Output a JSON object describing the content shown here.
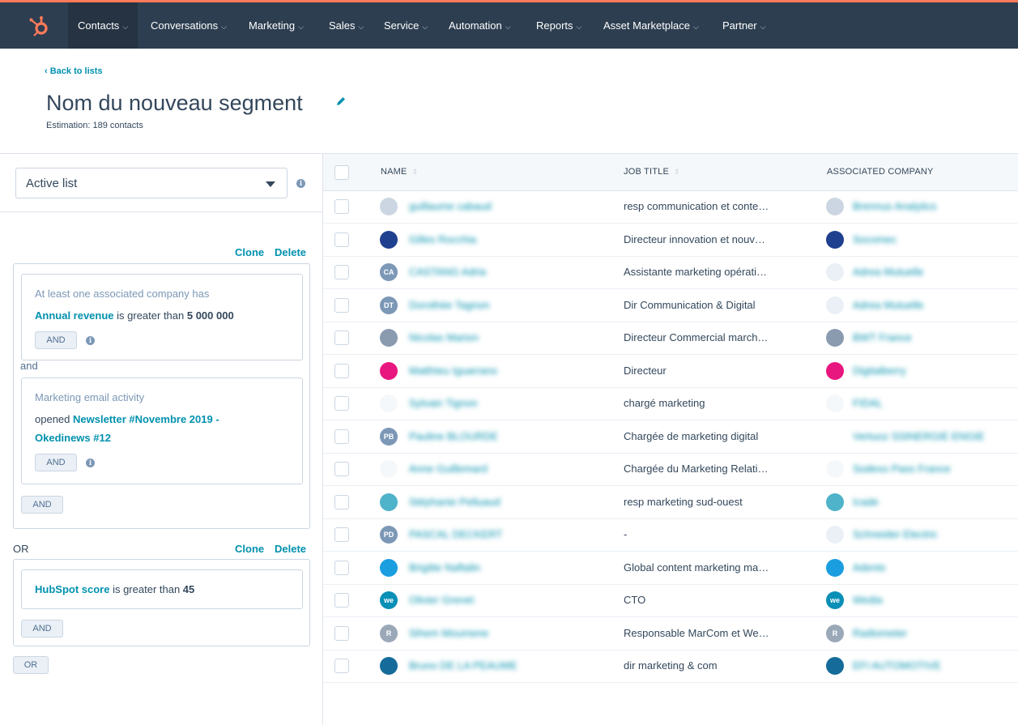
{
  "nav": {
    "items": [
      {
        "label": "Contacts"
      },
      {
        "label": "Conversations"
      },
      {
        "label": "Marketing"
      },
      {
        "label": "Sales"
      },
      {
        "label": "Service"
      },
      {
        "label": "Automation"
      },
      {
        "label": "Reports"
      },
      {
        "label": "Asset Marketplace"
      },
      {
        "label": "Partner"
      }
    ]
  },
  "header": {
    "back_link": "‹  Back to lists",
    "title": "Nom du nouveau segment",
    "estimate": "Estimation: 189 contacts"
  },
  "filters": {
    "list_type": "Active list",
    "clone_label": "Clone",
    "delete_label": "Delete",
    "and_connector": "and",
    "or_label": "OR",
    "and_button": "AND",
    "or_button": "OR",
    "group1": {
      "filter1": {
        "title": "At least one associated company has",
        "property": "Annual revenue",
        "operator": " is greater than ",
        "value": "5 000 000"
      },
      "filter2": {
        "title": "Marketing email activity",
        "operator": "opened ",
        "value_line1": "Newsletter #Novembre 2019 -",
        "value_line2": "Okedinews #12"
      }
    },
    "group2": {
      "filter1": {
        "property": "HubSpot score",
        "operator": " is greater than ",
        "value": "45"
      }
    }
  },
  "table": {
    "headers": {
      "name": "NAME",
      "job_title": "JOB TITLE",
      "company": "ASSOCIATED COMPANY"
    },
    "rows": [
      {
        "name": "guillaume cabaud",
        "job": "resp communication et conte…",
        "company": "Brennus Analytics",
        "initials": "",
        "color": "#cbd6e2",
        "cinitials": "",
        "ccolor": "#cbd6e2"
      },
      {
        "name": "Gilles Rocchia",
        "job": "Directeur innovation et nouv…",
        "company": "Socomec",
        "initials": "",
        "color": "#1f3f8f",
        "cinitials": "",
        "ccolor": "#1f3f8f"
      },
      {
        "name": "CASTANG Adria",
        "job": "Assistante marketing opérati…",
        "company": "Adrea Mutuelle",
        "initials": "CA",
        "color": "#7c98b6",
        "cinitials": "",
        "ccolor": "#eaf0f6"
      },
      {
        "name": "Dorothée Tagnon",
        "job": "Dir Communication & Digital",
        "company": "Adrea Mutuelle",
        "initials": "DT",
        "color": "#7c98b6",
        "cinitials": "",
        "ccolor": "#eaf0f6"
      },
      {
        "name": "Nicolas Marion",
        "job": "Directeur Commercial march…",
        "company": "BWT France",
        "initials": "",
        "color": "#8a9bb0",
        "cinitials": "",
        "ccolor": "#8a9bb0"
      },
      {
        "name": "Matthieu Iguarrano",
        "job": "Directeur",
        "company": "Digitalberry",
        "initials": "",
        "color": "#e8177f",
        "cinitials": "",
        "ccolor": "#e8177f"
      },
      {
        "name": "Sylvain Tignon",
        "job": "chargé marketing",
        "company": "FIDAL",
        "initials": "",
        "color": "#f5f8fa",
        "cinitials": "",
        "ccolor": "#f5f8fa"
      },
      {
        "name": "Pauline BLOURDE",
        "job": "Chargée de marketing digital",
        "company": "Vertuoz SSINERGIE ENGIE",
        "initials": "PB",
        "color": "#7c98b6",
        "cinitials": "",
        "ccolor": "#ffffff"
      },
      {
        "name": "Anne Guillemard",
        "job": "Chargée du Marketing Relati…",
        "company": "Sodexo Pass France",
        "initials": "",
        "color": "#f5f8fa",
        "cinitials": "",
        "ccolor": "#f5f8fa"
      },
      {
        "name": "Stéphanie Pelluaud",
        "job": "resp marketing sud-ouest",
        "company": "Icade",
        "initials": "",
        "color": "#4fb3c9",
        "cinitials": "",
        "ccolor": "#4fb3c9"
      },
      {
        "name": "PASCAL DECKERT",
        "job": "-",
        "company": "Schneider Electric",
        "initials": "PD",
        "color": "#7c98b6",
        "cinitials": "",
        "ccolor": "#eaf0f6"
      },
      {
        "name": "Brigitte Naftalin",
        "job": "Global content marketing ma…",
        "company": "Adents",
        "initials": "",
        "color": "#1b9ee0",
        "cinitials": "",
        "ccolor": "#1b9ee0"
      },
      {
        "name": "Olivier Grenet",
        "job": "CTO",
        "company": "Wedia",
        "initials": "we",
        "color": "#0a8fb6",
        "cinitials": "we",
        "ccolor": "#0a8fb6"
      },
      {
        "name": "Sihem Moumene",
        "job": "Responsable MarCom et We…",
        "company": "Radiometer",
        "initials": "R",
        "color": "#9aa8b8",
        "cinitials": "R",
        "ccolor": "#9aa8b8"
      },
      {
        "name": "Bruno DE LA PEAUME",
        "job": "dir marketing & com",
        "company": "EFI AUTOMOTIVE",
        "initials": "",
        "color": "#156c9a",
        "cinitials": "",
        "ccolor": "#156c9a"
      }
    ]
  }
}
